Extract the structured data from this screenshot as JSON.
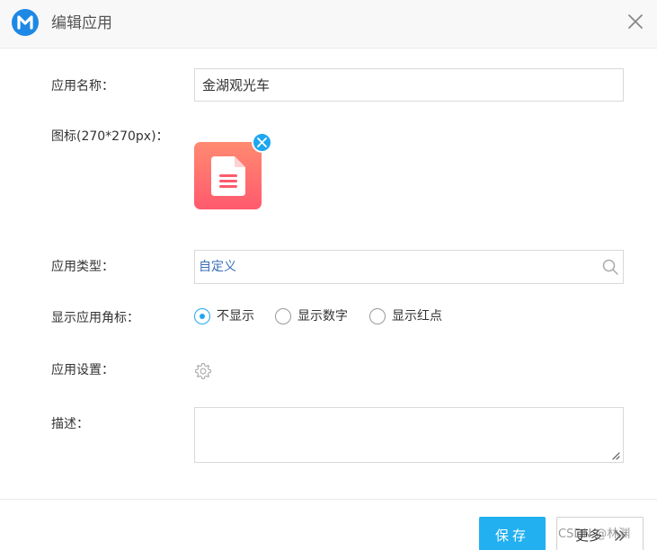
{
  "dialog": {
    "title": "编辑应用",
    "logo_icon": "m-logo-icon",
    "close_icon": "close-icon"
  },
  "form": {
    "name": {
      "label": "应用名称：",
      "value": "金湖观光车",
      "placeholder": ""
    },
    "icon": {
      "label": "图标(270*270px)：",
      "image_icon": "document-icon",
      "remove_icon": "close-circle-icon"
    },
    "type": {
      "label": "应用类型：",
      "value": "自定义",
      "icon": "search-icon"
    },
    "badge": {
      "label": "显示应用角标：",
      "options": [
        {
          "label": "不显示",
          "checked": true
        },
        {
          "label": "显示数字",
          "checked": false
        },
        {
          "label": "显示红点",
          "checked": false
        }
      ]
    },
    "settings": {
      "label": "应用设置：",
      "icon": "gear-icon"
    },
    "description": {
      "label": "描述：",
      "value": ""
    }
  },
  "footer": {
    "save_label": "保存",
    "more_label": "更多",
    "more_icon": "double-chevron-right-icon",
    "watermark": "CSDN @林渊"
  },
  "colors": {
    "accent": "#22b0f0",
    "logo": "#1e88e5",
    "link": "#3a6fb7",
    "icon_gradient_top": "#ff8a70",
    "icon_gradient_bottom": "#ff5a6e"
  }
}
